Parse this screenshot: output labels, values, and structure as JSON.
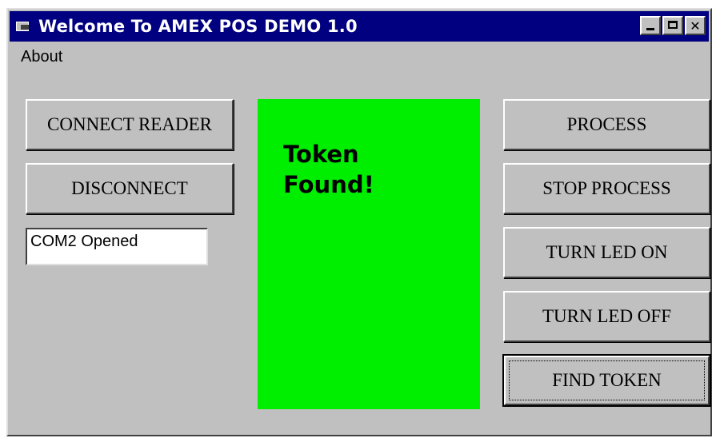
{
  "window": {
    "title": "Welcome To AMEX POS DEMO 1.0"
  },
  "menu": [
    "About"
  ],
  "left_buttons": {
    "connect": "CONNECT READER",
    "disconnect": "DISCONNECT"
  },
  "status_field": {
    "value": "COM2 Opened"
  },
  "token_panel": {
    "message": "Token Found!",
    "background_color": "#00ee00"
  },
  "right_buttons": {
    "process": "PROCESS",
    "stop_process": "STOP PROCESS",
    "turn_led_on": "TURN LED ON",
    "turn_led_off": "TURN LED OFF",
    "find_token": "FIND TOKEN"
  },
  "colors": {
    "titlebar": "#000080",
    "window_face": "#c0c0c0"
  }
}
